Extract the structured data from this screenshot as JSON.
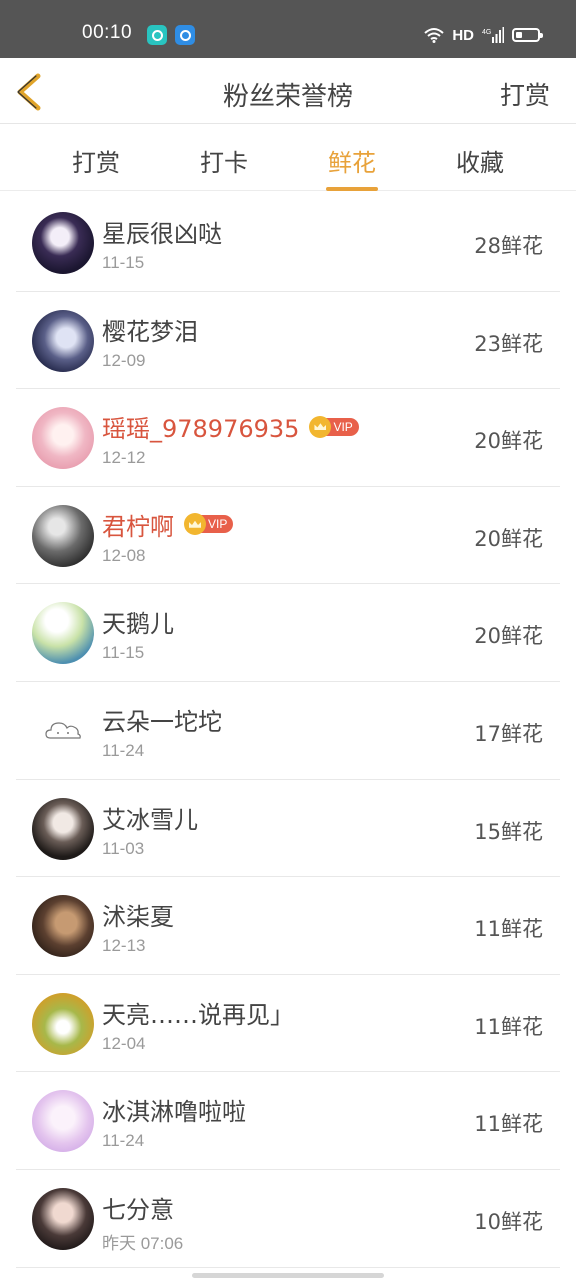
{
  "status_bar": {
    "time": "00:10",
    "hd": "HD"
  },
  "nav": {
    "title": "粉丝荣誉榜",
    "right_action": "打赏"
  },
  "tabs": [
    {
      "label": "打赏"
    },
    {
      "label": "打卡"
    },
    {
      "label": "鲜花"
    },
    {
      "label": "收藏"
    }
  ],
  "active_tab": "鲜花",
  "colors": {
    "accent": "#e8a23a",
    "vip_name": "#d8553e",
    "status_bar": "#555555"
  },
  "vip_label": "VIP",
  "fans": [
    {
      "name": "星辰很凶哒",
      "date": "11-15",
      "count": "28鲜花",
      "vip": false
    },
    {
      "name": "樱花梦泪",
      "date": "12-09",
      "count": "23鲜花",
      "vip": false
    },
    {
      "name": "瑶瑶_978976935",
      "date": "12-12",
      "count": "20鲜花",
      "vip": true
    },
    {
      "name": "君柠啊",
      "date": "12-08",
      "count": "20鲜花",
      "vip": true
    },
    {
      "name": "天鹅儿",
      "date": "11-15",
      "count": "20鲜花",
      "vip": false
    },
    {
      "name": "云朵一坨坨",
      "date": "11-24",
      "count": "17鲜花",
      "vip": false
    },
    {
      "name": "艾冰雪儿",
      "date": "11-03",
      "count": "15鲜花",
      "vip": false
    },
    {
      "name": "沭柒夏",
      "date": "12-13",
      "count": "11鲜花",
      "vip": false
    },
    {
      "name": "天亮……说再见」",
      "date": "12-04",
      "count": "11鲜花",
      "vip": false
    },
    {
      "name": "冰淇淋噜啦啦",
      "date": "11-24",
      "count": "11鲜花",
      "vip": false
    },
    {
      "name": "七分意",
      "date": "昨天 07:06",
      "count": "10鲜花",
      "vip": false
    }
  ]
}
